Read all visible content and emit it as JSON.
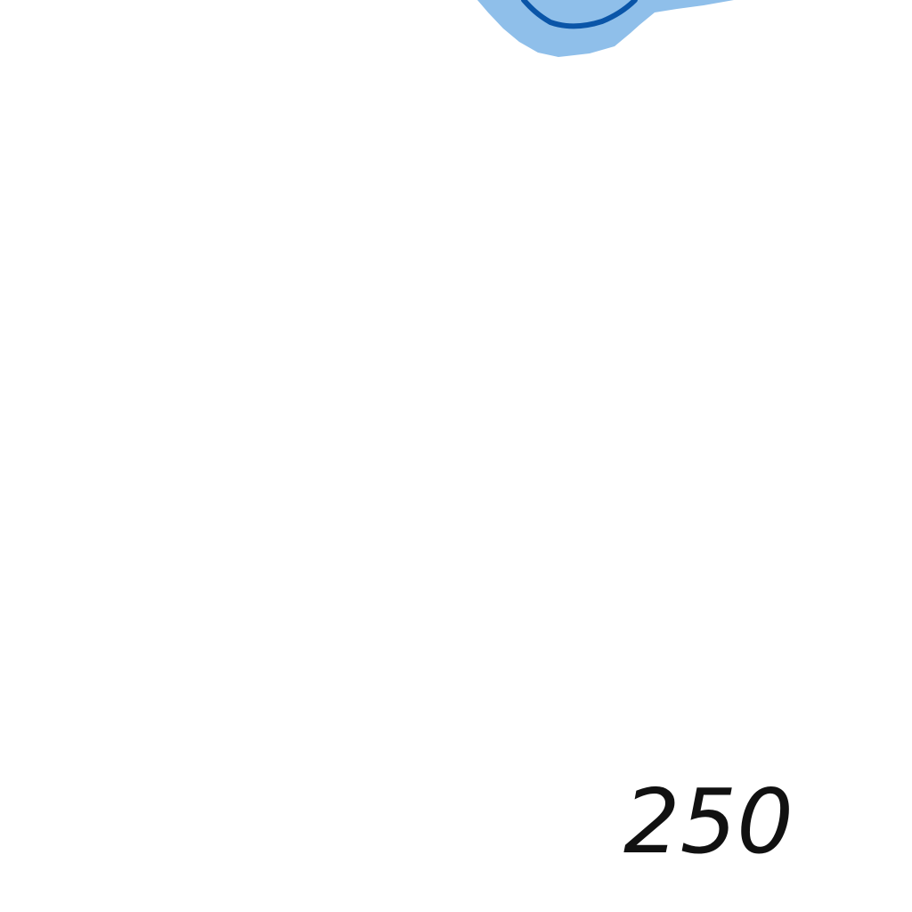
{
  "chart_data": {
    "type": "line",
    "title": "",
    "xlabel": "",
    "ylabel": "",
    "grid": false,
    "series": [
      {
        "line_color": "#0a55a8",
        "band_color": "#8fbfea",
        "values": []
      }
    ],
    "x_tick_labels": [
      "250"
    ]
  }
}
